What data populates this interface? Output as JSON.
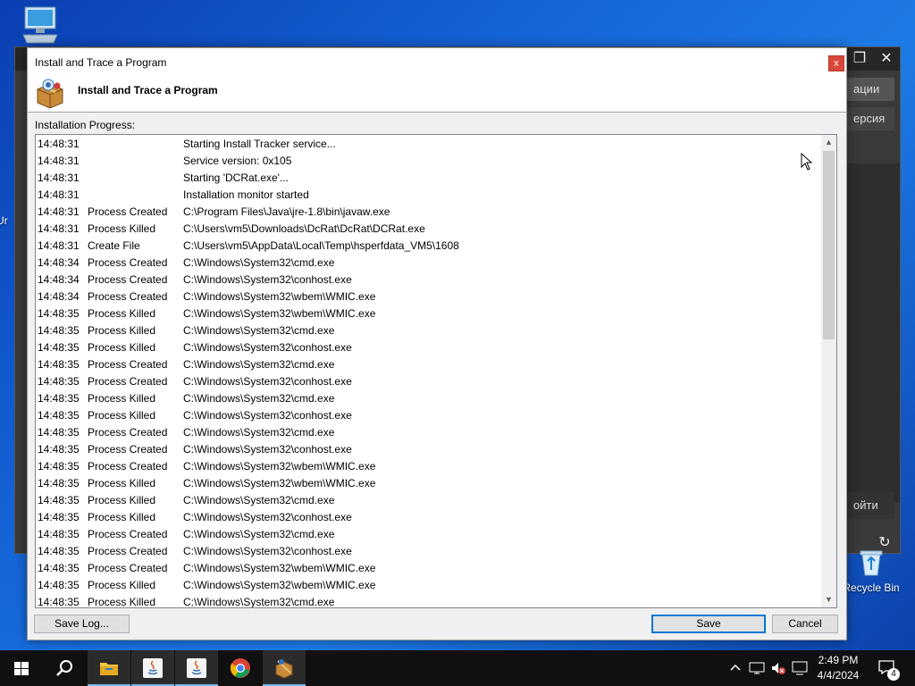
{
  "desktop": {
    "recycle_bin_label": "Recycle Bin",
    "partial_label": "Ur"
  },
  "background_window": {
    "panel1": "ации",
    "panel2": "ерсия",
    "panel3": "ойти"
  },
  "dialog": {
    "title": "Install and Trace a Program",
    "header_title": "Install and Trace a Program",
    "close_label": "x",
    "progress_label": "Installation Progress:",
    "save_log_label": "Save Log...",
    "save_label": "Save",
    "cancel_label": "Cancel"
  },
  "log": [
    {
      "time": "14:48:31",
      "action": "",
      "detail": "Starting Install Tracker service..."
    },
    {
      "time": "14:48:31",
      "action": "",
      "detail": "Service version: 0x105"
    },
    {
      "time": "14:48:31",
      "action": "",
      "detail": "Starting 'DCRat.exe'..."
    },
    {
      "time": "14:48:31",
      "action": "",
      "detail": "Installation monitor started"
    },
    {
      "time": "14:48:31",
      "action": "Process Created",
      "detail": "C:\\Program Files\\Java\\jre-1.8\\bin\\javaw.exe"
    },
    {
      "time": "14:48:31",
      "action": "Process Killed",
      "detail": "C:\\Users\\vm5\\Downloads\\DcRat\\DcRat\\DCRat.exe"
    },
    {
      "time": "14:48:31",
      "action": "Create File",
      "detail": "C:\\Users\\vm5\\AppData\\Local\\Temp\\hsperfdata_VM5\\1608"
    },
    {
      "time": "14:48:34",
      "action": "Process Created",
      "detail": "C:\\Windows\\System32\\cmd.exe"
    },
    {
      "time": "14:48:34",
      "action": "Process Created",
      "detail": "C:\\Windows\\System32\\conhost.exe"
    },
    {
      "time": "14:48:34",
      "action": "Process Created",
      "detail": "C:\\Windows\\System32\\wbem\\WMIC.exe"
    },
    {
      "time": "14:48:35",
      "action": "Process Killed",
      "detail": "C:\\Windows\\System32\\wbem\\WMIC.exe"
    },
    {
      "time": "14:48:35",
      "action": "Process Killed",
      "detail": "C:\\Windows\\System32\\cmd.exe"
    },
    {
      "time": "14:48:35",
      "action": "Process Killed",
      "detail": "C:\\Windows\\System32\\conhost.exe"
    },
    {
      "time": "14:48:35",
      "action": "Process Created",
      "detail": "C:\\Windows\\System32\\cmd.exe"
    },
    {
      "time": "14:48:35",
      "action": "Process Created",
      "detail": "C:\\Windows\\System32\\conhost.exe"
    },
    {
      "time": "14:48:35",
      "action": "Process Killed",
      "detail": "C:\\Windows\\System32\\cmd.exe"
    },
    {
      "time": "14:48:35",
      "action": "Process Killed",
      "detail": "C:\\Windows\\System32\\conhost.exe"
    },
    {
      "time": "14:48:35",
      "action": "Process Created",
      "detail": "C:\\Windows\\System32\\cmd.exe"
    },
    {
      "time": "14:48:35",
      "action": "Process Created",
      "detail": "C:\\Windows\\System32\\conhost.exe"
    },
    {
      "time": "14:48:35",
      "action": "Process Created",
      "detail": "C:\\Windows\\System32\\wbem\\WMIC.exe"
    },
    {
      "time": "14:48:35",
      "action": "Process Killed",
      "detail": "C:\\Windows\\System32\\wbem\\WMIC.exe"
    },
    {
      "time": "14:48:35",
      "action": "Process Killed",
      "detail": "C:\\Windows\\System32\\cmd.exe"
    },
    {
      "time": "14:48:35",
      "action": "Process Killed",
      "detail": "C:\\Windows\\System32\\conhost.exe"
    },
    {
      "time": "14:48:35",
      "action": "Process Created",
      "detail": "C:\\Windows\\System32\\cmd.exe"
    },
    {
      "time": "14:48:35",
      "action": "Process Created",
      "detail": "C:\\Windows\\System32\\conhost.exe"
    },
    {
      "time": "14:48:35",
      "action": "Process Created",
      "detail": "C:\\Windows\\System32\\wbem\\WMIC.exe"
    },
    {
      "time": "14:48:35",
      "action": "Process Killed",
      "detail": "C:\\Windows\\System32\\wbem\\WMIC.exe"
    },
    {
      "time": "14:48:35",
      "action": "Process Killed",
      "detail": "C:\\Windows\\System32\\cmd.exe"
    }
  ],
  "taskbar": {
    "items": [
      "start-icon",
      "search-icon",
      "file-explorer-icon",
      "java-icon",
      "java-icon",
      "chrome-icon",
      "installer-icon"
    ],
    "time": "2:49 PM",
    "date": "4/4/2024",
    "notification_count": "4"
  },
  "colors": {
    "accent": "#0078d7",
    "close_button": "#d9473a",
    "taskbar": "#101010"
  }
}
